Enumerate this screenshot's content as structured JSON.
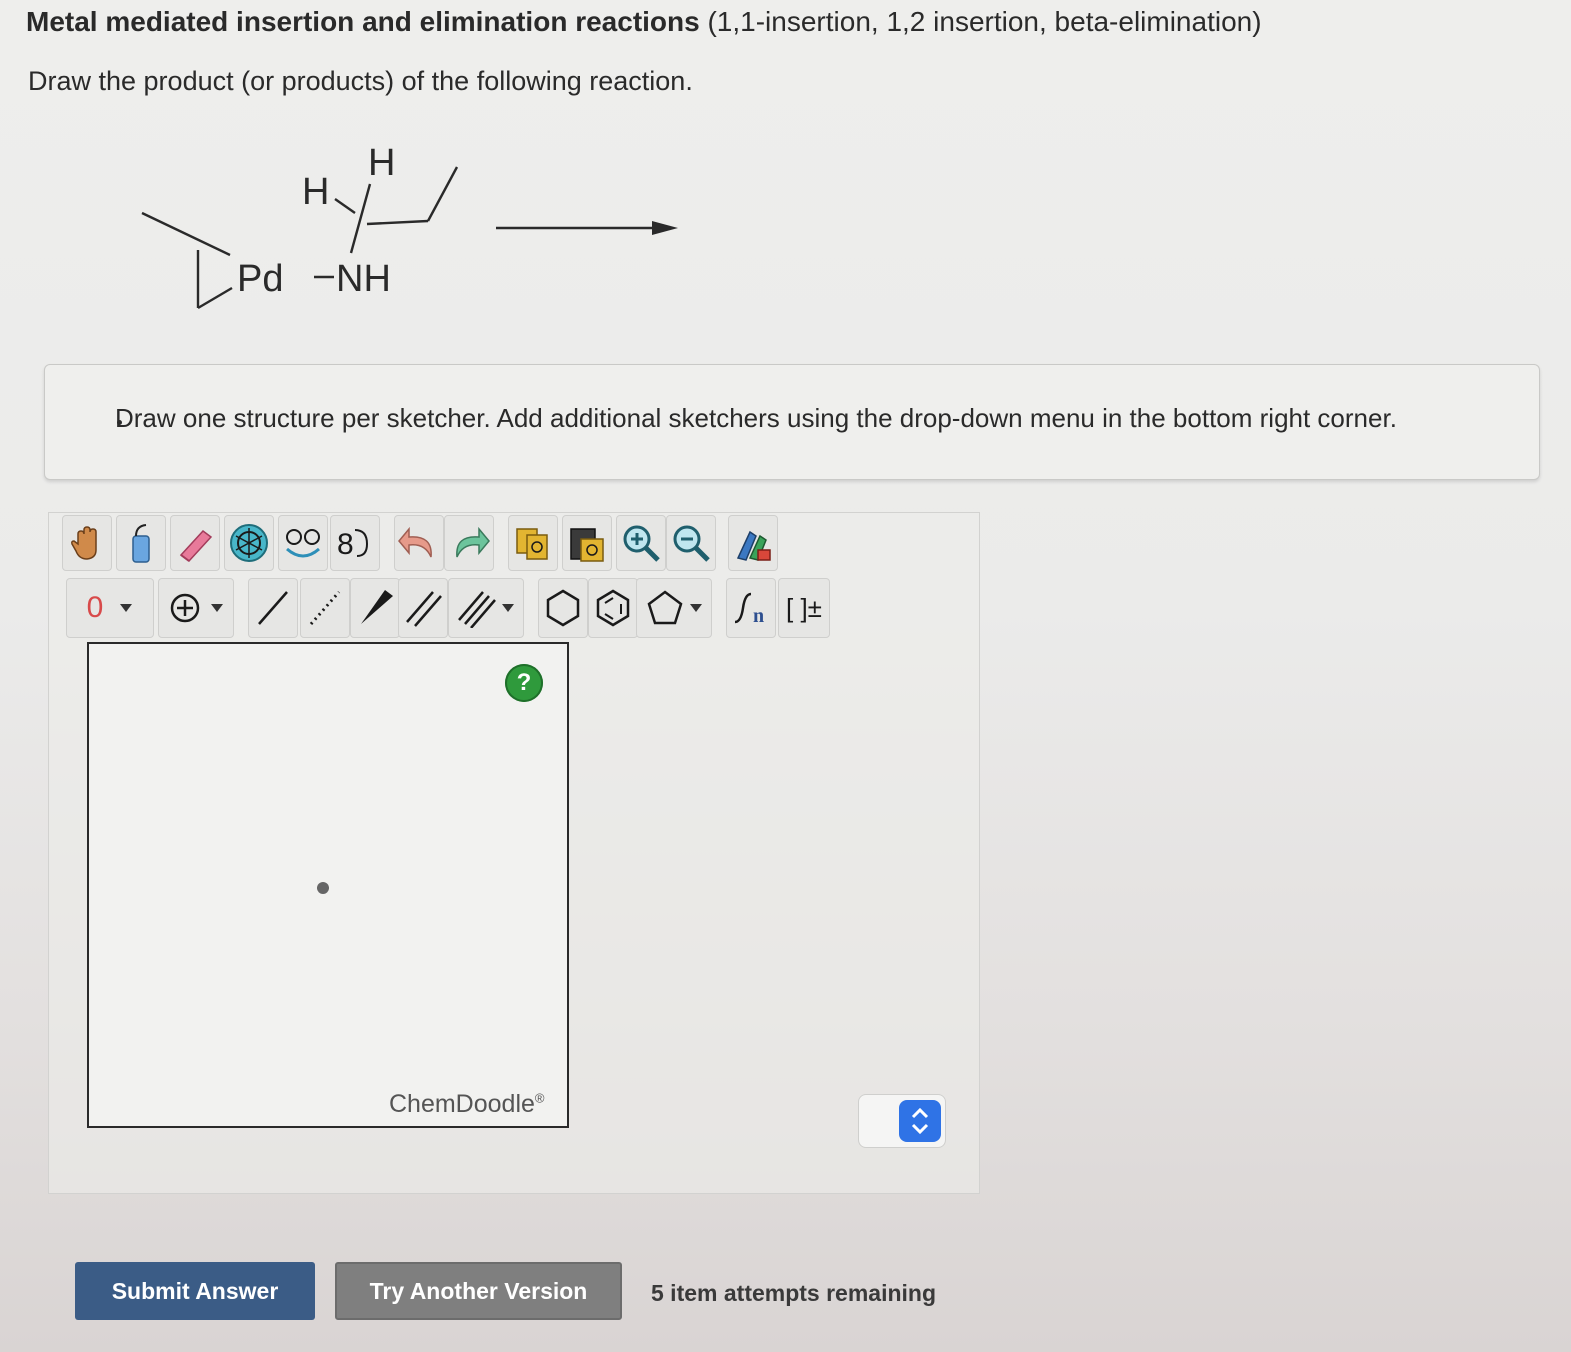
{
  "header": {
    "title_bold": "Metal mediated insertion and elimination reactions",
    "title_rest": "(1,1-insertion, 1,2 insertion, beta-elimination)",
    "prompt": "Draw the product (or products) of the following reaction."
  },
  "reaction": {
    "label_h_top": "H",
    "label_h_left": "H",
    "label_metal": "Pd",
    "label_nh": "NH"
  },
  "notice": {
    "text": "Draw one structure per sketcher. Add additional sketchers using the drop-down menu in the bottom right corner."
  },
  "toolbar": {
    "charge_value": "0",
    "row1_icons": [
      "hand-icon",
      "lasso-icon",
      "eraser-icon",
      "templates-icon",
      "rings-templates-icon",
      "atom-numbering-icon",
      "undo-icon",
      "redo-icon",
      "copy-icon",
      "paste-icon",
      "zoom-in-icon",
      "zoom-out-icon",
      "clean-icon"
    ],
    "row2_icons": [
      "charge-icon",
      "add-charge-icon",
      "single-bond-icon",
      "dashed-bond-icon",
      "wedge-bond-icon",
      "double-bond-icon",
      "triple-bond-icon",
      "hexagon-icon",
      "benzene-icon",
      "pentagon-icon",
      "repeat-unit-icon",
      "bracket-icon"
    ],
    "bracket_label": "[ ]±"
  },
  "canvas": {
    "help_label": "?",
    "brand": "ChemDoodle",
    "brand_mark": "®"
  },
  "actions": {
    "submit_label": "Submit Answer",
    "try_label": "Try Another Version",
    "attempts_text": "5 item attempts remaining"
  },
  "colors": {
    "submit_bg": "#3b5c86",
    "try_bg": "#7f7f7f",
    "help_green": "#2f9a3c",
    "stepper_blue": "#2f73e6"
  }
}
